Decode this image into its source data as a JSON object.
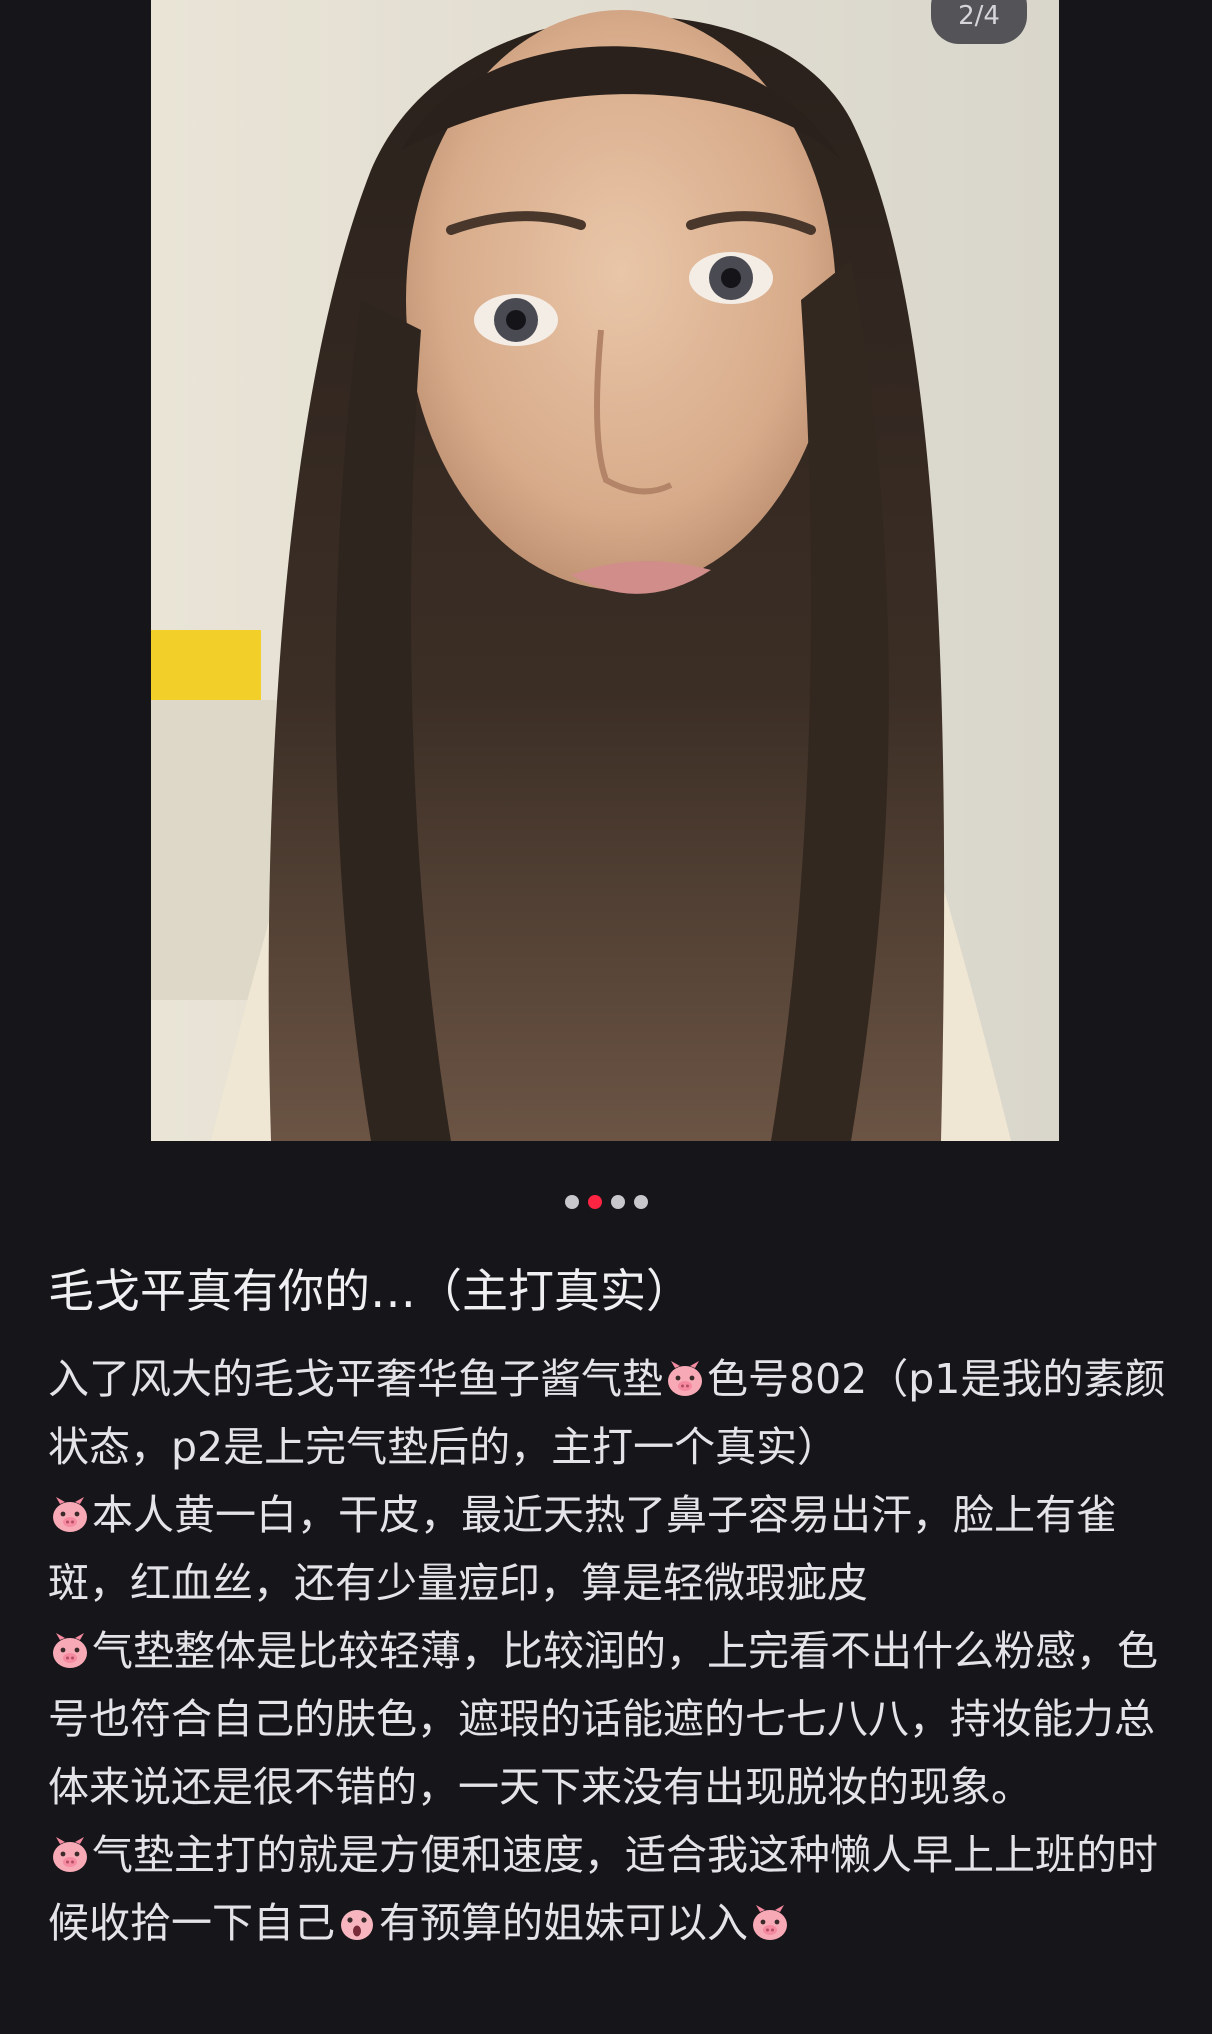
{
  "image_viewer": {
    "page_counter": "2/4",
    "image_description": "selfie photo",
    "dots": [
      false,
      true,
      false,
      false
    ]
  },
  "post": {
    "title": "毛戈平真有你的…（主打真实）",
    "paragraphs": [
      {
        "before": "入了风大的毛戈平奢华鱼子酱气垫",
        "icon": "pig-icon",
        "after": "色号802（p1是我的素颜状态，p2是上完气垫后的，主打一个真实）"
      },
      {
        "before": "",
        "icon": "pig-icon",
        "after": "本人黄一白，干皮，最近天热了鼻子容易出汗，脸上有雀斑，红血丝，还有少量痘印，算是轻微瑕疵皮"
      },
      {
        "before": "",
        "icon": "pig-icon",
        "after": "气垫整体是比较轻薄，比较润的，上完看不出什么粉感，色号也符合自己的肤色，遮瑕的话能遮的七七八八，持妆能力总体来说还是很不错的，一天下来没有出现脱妆的现象。"
      },
      {
        "before": "",
        "icon": "pig-icon",
        "after": "气垫主打的就是方便和速度，适合我这种懒人早上上班的时候收拾一下自己"
      },
      {
        "before": "",
        "icon": "shocked-face-icon",
        "after": "有预算的姐妹可以入"
      }
    ]
  },
  "colors": {
    "background": "#16161a",
    "accent": "#ff2442",
    "text": "#e4e4e8"
  }
}
